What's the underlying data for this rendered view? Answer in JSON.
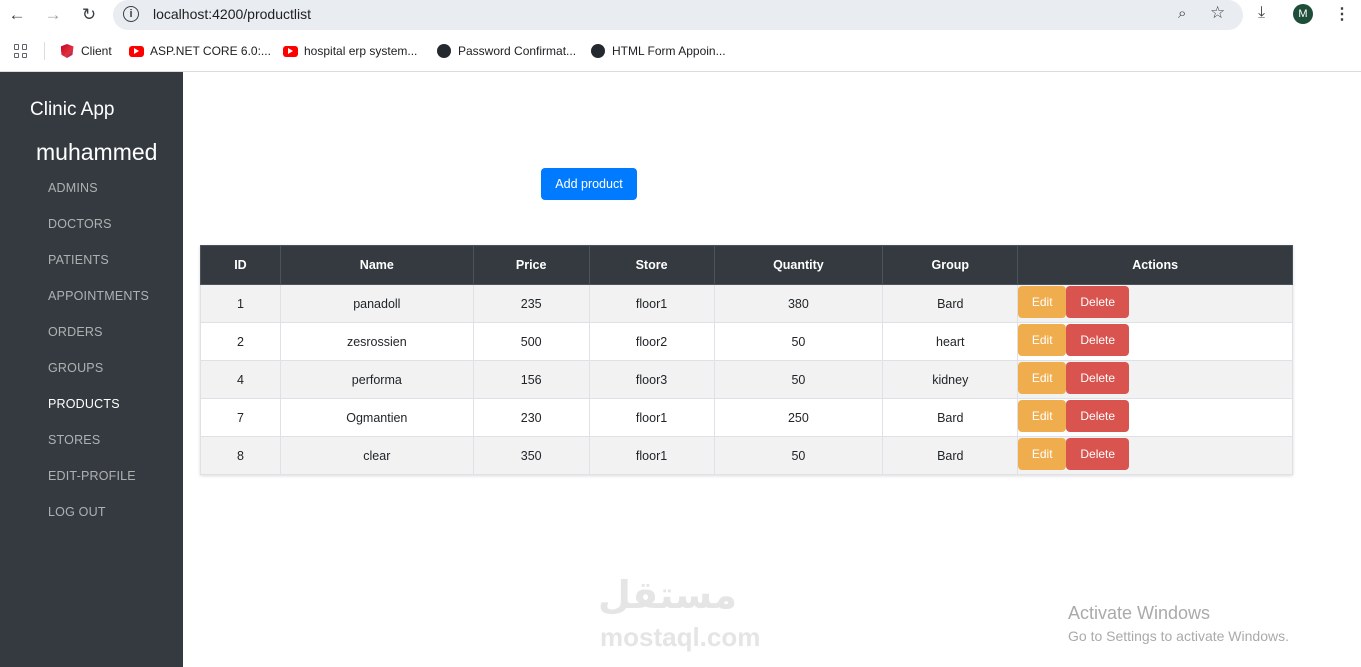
{
  "browser": {
    "url": "localhost:4200/productlist",
    "back_icon": "←",
    "forward_icon": "→",
    "reload_icon": "↻",
    "info_icon": "i",
    "zoom_icon": "⌕",
    "star_icon": "☆",
    "download_icon": "⤓",
    "profile_initial": "M",
    "menu_icon": "⋮",
    "bookmarks": [
      {
        "label": "Client",
        "icon": "angular-icon"
      },
      {
        "label": "ASP.NET CORE 6.0:...",
        "icon": "youtube-icon"
      },
      {
        "label": "hospital erp system...",
        "icon": "youtube-icon"
      },
      {
        "label": "Password Confirmat...",
        "icon": "github-icon"
      },
      {
        "label": "HTML Form Appoin...",
        "icon": "github-icon"
      }
    ]
  },
  "sidebar": {
    "brand": "Clinic App",
    "username": "muhammed",
    "items": [
      {
        "label": "ADMINS"
      },
      {
        "label": "DOCTORS"
      },
      {
        "label": "PATIENTS"
      },
      {
        "label": "APPOINTMENTS"
      },
      {
        "label": "ORDERS"
      },
      {
        "label": "GROUPS"
      },
      {
        "label": "PRODUCTS",
        "active": true
      },
      {
        "label": "STORES"
      },
      {
        "label": "EDIT-PROFILE"
      },
      {
        "label": "LOG OUT"
      }
    ]
  },
  "main": {
    "add_button": "Add product",
    "table": {
      "headers": [
        "ID",
        "Name",
        "Price",
        "Store",
        "Quantity",
        "Group",
        "Actions"
      ],
      "rows": [
        [
          "1",
          "panadoll",
          "235",
          "floor1",
          "380",
          "Bard"
        ],
        [
          "2",
          "zesrossien",
          "500",
          "floor2",
          "50",
          "heart"
        ],
        [
          "4",
          "performa",
          "156",
          "floor3",
          "50",
          "kidney"
        ],
        [
          "7",
          "Ogmantien",
          "230",
          "floor1",
          "250",
          "Bard"
        ],
        [
          "8",
          "clear",
          "350",
          "floor1",
          "50",
          "Bard"
        ]
      ],
      "edit_label": "Edit",
      "delete_label": "Delete"
    }
  },
  "watermark": {
    "logo": "مستقل",
    "site": "mostaql.com"
  },
  "os_notice": {
    "title": "Activate Windows",
    "subtitle": "Go to Settings to activate Windows."
  },
  "colors": {
    "sidebar_bg": "#343a40",
    "primary": "#007bff",
    "warning": "#f0ad4e",
    "danger": "#d9534f"
  }
}
